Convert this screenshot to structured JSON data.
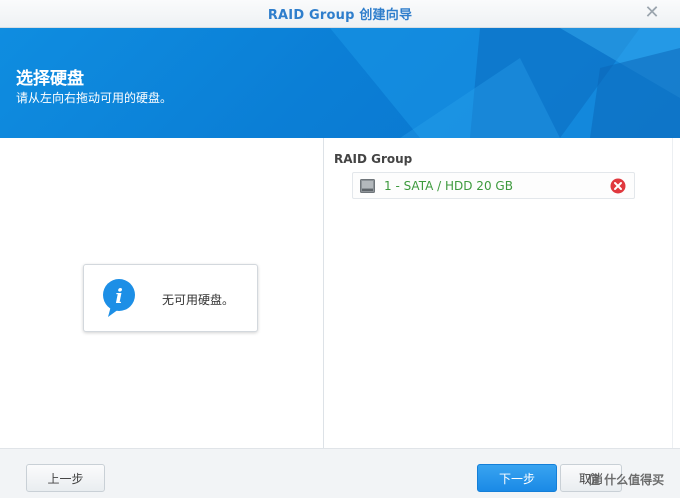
{
  "window": {
    "title": "RAID Group 创建向导",
    "close_glyph": "✕"
  },
  "banner": {
    "title": "选择硬盘",
    "subtitle": "请从左向右拖动可用的硬盘。"
  },
  "left_pane": {
    "empty_message": "无可用硬盘。",
    "icon": "info-icon"
  },
  "right_pane": {
    "label": "RAID Group",
    "disks": [
      {
        "label": "1 - SATA / HDD 20 GB",
        "icon": "hdd-icon",
        "remove_icon": "remove-icon"
      }
    ]
  },
  "footer": {
    "prev_label": "上一步",
    "next_label": "下一步",
    "cancel_label": "取消",
    "watermark": "值 什么值得买"
  },
  "colors": {
    "accent": "#1a8ae6",
    "banner": "#0b7fd6",
    "disk_text": "#3d9a3d",
    "remove": "#e0383e"
  }
}
